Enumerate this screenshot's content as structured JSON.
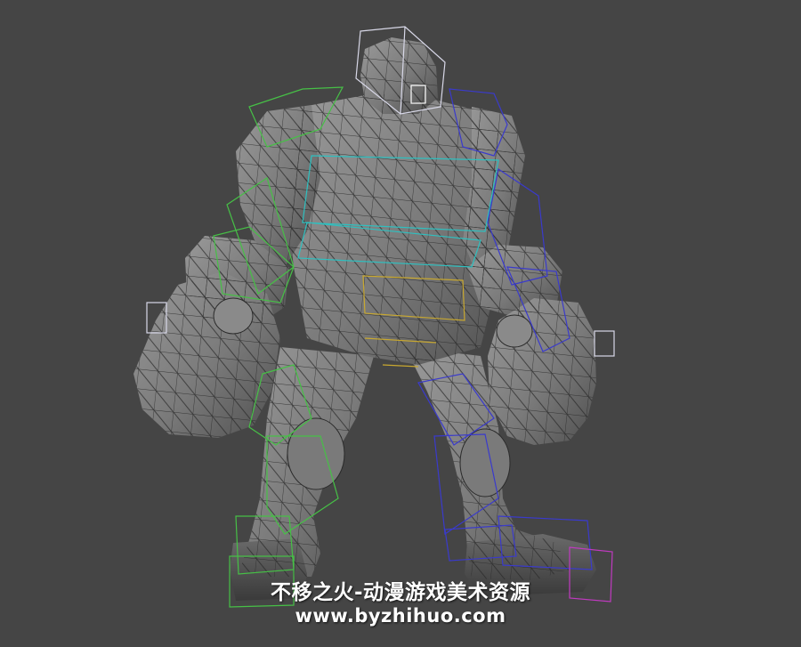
{
  "viewport": {
    "background": "#454545",
    "mesh_fill": "#7d7d7d",
    "mesh_edge": "#2a2a2a",
    "bone_colors": {
      "head": "#d8d8e8",
      "spine": "#c8a830",
      "left_arm": "#46c046",
      "right_arm": "#3a3acc",
      "torso_rig": "#2ec0c0",
      "left_leg": "#46c046",
      "right_leg": "#3a3acc",
      "right_foot": "#c03ac0"
    },
    "model_icon": "character-mesh-icon"
  },
  "watermark": {
    "line1": "不移之火-动漫游戏美术资源",
    "line2": "www.byzhihuo.com"
  }
}
